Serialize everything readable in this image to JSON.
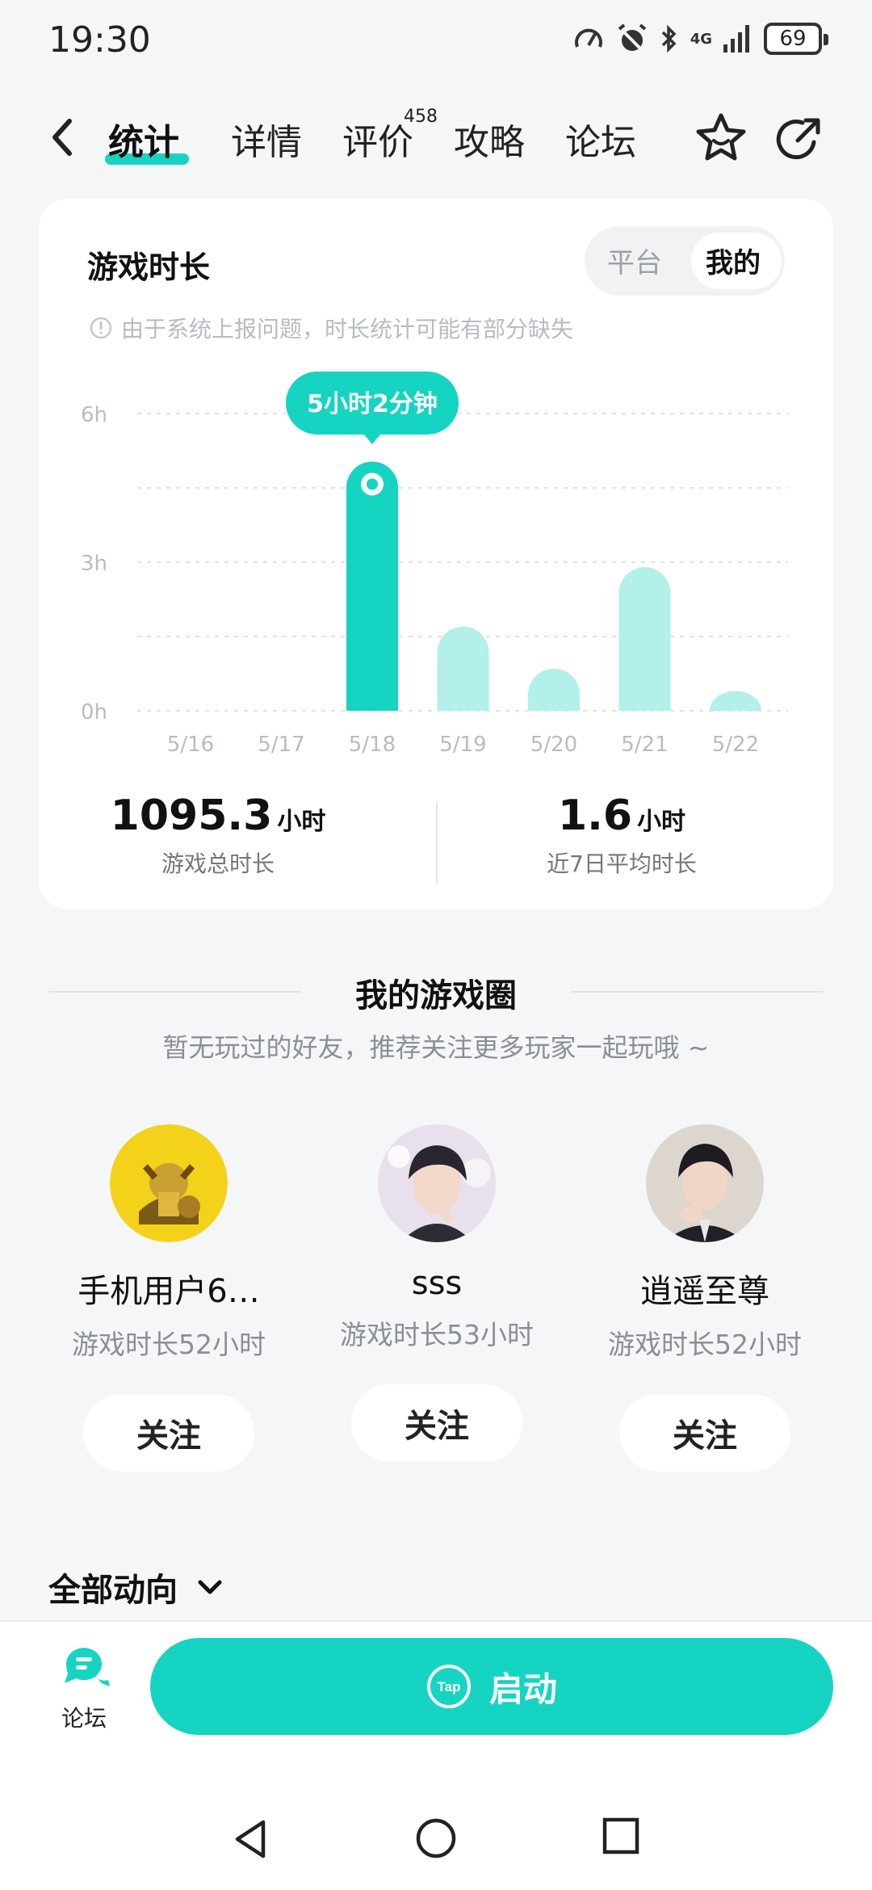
{
  "status": {
    "time": "19:30",
    "network": "4G",
    "battery": "69"
  },
  "nav": {
    "tabs": [
      "统计",
      "详情",
      "评价",
      "攻略",
      "论坛"
    ],
    "review_count": "458"
  },
  "playtime": {
    "title": "游戏时长",
    "toggle": [
      "平台",
      "我的"
    ],
    "notice": "由于系统上报问题，时长统计可能有部分缺失",
    "tooltip": "5小时2分钟",
    "total_value": "1095.3",
    "total_unit": "小时",
    "total_label": "游戏总时长",
    "avg_value": "1.6",
    "avg_unit": "小时",
    "avg_label": "近7日平均时长"
  },
  "chart_data": {
    "type": "bar",
    "categories": [
      "5/16",
      "5/17",
      "5/18",
      "5/19",
      "5/20",
      "5/21",
      "5/22"
    ],
    "values": [
      0,
      0,
      5.03,
      1.7,
      0.85,
      2.9,
      0.4
    ],
    "y_ticks": [
      "6h",
      "3h",
      "0h"
    ],
    "ylim": [
      0,
      6
    ],
    "highlight_index": 2,
    "colors": {
      "highlight": "#16d4c2",
      "normal": "#b3f0ea"
    }
  },
  "circle": {
    "title": "我的游戏圈",
    "subtitle": "暂无玩过的好友，推荐关注更多玩家一起玩哦 ~",
    "friends": [
      {
        "name": "手机用户6…",
        "time": "游戏时长52小时",
        "follow": "关注"
      },
      {
        "name": "sss",
        "time": "游戏时长53小时",
        "follow": "关注"
      },
      {
        "name": "逍遥至尊",
        "time": "游戏时长52小时",
        "follow": "关注"
      }
    ]
  },
  "feed": {
    "label": "全部动向"
  },
  "bottom": {
    "forum_label": "论坛",
    "launch_label": "启动",
    "tap_logo_text": "Tap"
  },
  "colors": {
    "accent": "#16d4c2",
    "accent_light": "#b3f0ea"
  }
}
